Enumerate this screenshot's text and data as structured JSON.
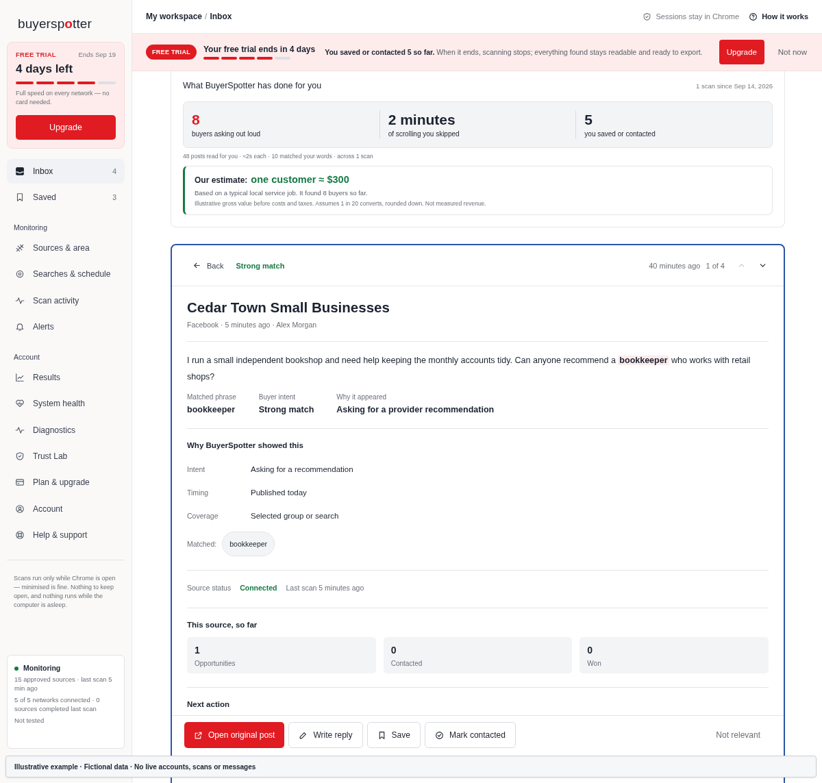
{
  "sidebar": {
    "logo": {
      "before": "buyersp",
      "mark": "o",
      "after": "tter"
    },
    "trial": {
      "badge": "FREE TRIAL",
      "ends": "Ends Sep 19",
      "headline": "4 days left",
      "level": 0.8,
      "note": "Full speed on every network — no card needed.",
      "button": "Upgrade"
    },
    "nav": [
      {
        "label": "Inbox",
        "count": "4",
        "selected": true
      },
      {
        "label": "Saved",
        "count": "3",
        "selected": false
      }
    ],
    "sections": [
      {
        "heading": "Monitoring",
        "items": [
          {
            "label": "Sources & area",
            "selected": false
          },
          {
            "label": "Searches & schedule",
            "selected": false
          },
          {
            "label": "Scan activity",
            "selected": false
          },
          {
            "label": "Alerts",
            "selected": false
          }
        ]
      },
      {
        "heading": "Account",
        "items": [
          {
            "label": "Results",
            "selected": false
          },
          {
            "label": "System health",
            "selected": false
          },
          {
            "label": "Diagnostics",
            "selected": false
          },
          {
            "label": "Trust Lab",
            "selected": false
          },
          {
            "label": "Plan & upgrade",
            "selected": false
          },
          {
            "label": "Account",
            "selected": false
          },
          {
            "label": "Help & support",
            "selected": false
          }
        ]
      }
    ],
    "footnote": "Scans run only while Chrome is open — minimised is fine. Nothing to keep open, and nothing runs while the computer is asleep.",
    "monitor": {
      "title": "Monitoring",
      "lines": [
        "15 approved sources · last scan 5 min ago",
        "5 of 5 networks connected · 0 sources completed last scan"
      ],
      "test_status": "Not tested"
    }
  },
  "topbar": {
    "breadcrumb": [
      "My workspace",
      "Inbox"
    ],
    "separator": "/",
    "session_note": "Sessions stay in Chrome",
    "help": "How it works"
  },
  "banner": {
    "badge": "FREE TRIAL",
    "title": "Your free trial ends in 4 days",
    "level": 0.8,
    "message": "**You saved or contacted 5 so far.** When it ends, scanning stops; everything found stays readable and ready to export.",
    "primary": "Upgrade",
    "secondary": "Not now"
  },
  "summary": {
    "title": "What BuyerSpotter has done for you",
    "since": "1 scan since Sep 14, 2026",
    "stats": [
      {
        "value": "8",
        "label": "buyers asking out loud",
        "kind": "alert"
      },
      {
        "value": "2 minutes",
        "label": "of scrolling you skipped",
        "kind": "plain"
      },
      {
        "value": "5",
        "label": "you saved or contacted",
        "kind": "plain"
      }
    ],
    "detail": "48 posts read for you · ≈2s each · 10 matched your words · across 1 scan",
    "estimate": {
      "label": "Our estimate:",
      "value": "one customer ≈ $300",
      "basis": "Based on a typical local service job. It found 8 buyers so far.",
      "disclaimer": "Illustrative gross value before costs and taxes. Assumes 1 in 20 converts, rounded down. Not measured revenue."
    }
  },
  "post": {
    "back": "Back",
    "match": "Strong match",
    "age": "40 minutes ago",
    "position": "1 of 4",
    "prev_disabled": true,
    "next_disabled": false,
    "title": "Cedar Town Small Businesses",
    "meta": "Facebook · 5 minutes ago · Alex Morgan",
    "body": "I run a small independent bookshop and need help keeping the monthly accounts tidy. Can anyone recommend a **bookkeeper** who works with retail shops?",
    "facts": [
      {
        "label": "Matched phrase",
        "value": "bookkeeper"
      },
      {
        "label": "Buyer intent",
        "value": "Strong match"
      },
      {
        "label": "Why it appeared",
        "value": "Asking for a provider recommendation"
      }
    ],
    "why": {
      "title": "Why BuyerSpotter showed this",
      "rows": [
        {
          "label": "Intent",
          "value": "Asking for a recommendation"
        },
        {
          "label": "Timing",
          "value": "Published today"
        },
        {
          "label": "Coverage",
          "value": "Selected group or search"
        }
      ],
      "matched_label": "Matched:",
      "matched_terms": [
        "bookkeeper"
      ]
    },
    "source": {
      "label": "Source status",
      "status": "Connected",
      "last_scan": "Last scan 5 minutes ago"
    },
    "so_far": {
      "title": "This source, so far",
      "stats": [
        {
          "value": "1",
          "label": "Opportunities"
        },
        {
          "value": "0",
          "label": "Contacted"
        },
        {
          "value": "0",
          "label": "Won"
        }
      ]
    },
    "next_action": "Next action",
    "actions": [
      {
        "label": "Open original post",
        "kind": "primary"
      },
      {
        "label": "Write reply",
        "kind": "secondary"
      },
      {
        "label": "Save",
        "kind": "secondary"
      },
      {
        "label": "Mark contacted",
        "kind": "secondary"
      },
      {
        "label": "Not relevant",
        "kind": "quiet"
      }
    ]
  },
  "notice": "Illustrative example · Fictional data · No live accounts, scans or messages"
}
